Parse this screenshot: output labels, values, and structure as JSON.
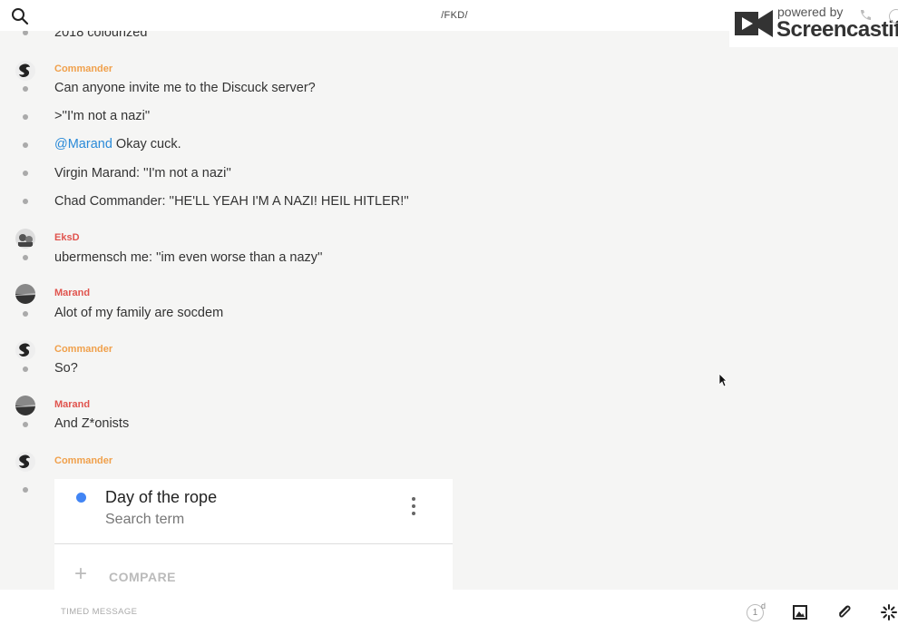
{
  "header": {
    "room_title": "/FKD/",
    "search_icon": "search-icon"
  },
  "watermark": {
    "powered_by": "powered by",
    "brand": "Screencastify"
  },
  "messages": {
    "partial_top": "2018 colourized",
    "g1": {
      "author": "Commander",
      "lines": [
        "Can anyone invite me to the Discuck server?",
        ">''I'm not a nazi''",
        "Okay cuck.",
        "Virgin Marand: ''I'm not a nazi''",
        "Chad Commander: ''HE'LL YEAH I'M A NAZI! HEIL HITLER!''"
      ],
      "mention": "@Marand"
    },
    "g2": {
      "author": "EksD",
      "lines": [
        "ubermensch me: ''im even worse than a nazy''"
      ]
    },
    "g3": {
      "author": "Marand",
      "lines": [
        "Alot of my family are socdem"
      ]
    },
    "g4": {
      "author": "Commander",
      "lines": [
        "So?"
      ]
    },
    "g5": {
      "author": "Marand",
      "lines": [
        "And Z*onists"
      ]
    },
    "g6": {
      "author": "Commander"
    }
  },
  "trend_card": {
    "title": "Day of the rope",
    "subtitle": "Search term",
    "compare_label": "COMPARE",
    "dot_color": "#4285f4"
  },
  "composer": {
    "placeholder": "TIMED MESSAGE",
    "timer_value": "1",
    "timer_unit": "d"
  },
  "colors": {
    "commander": "#f0a04b",
    "other_author": "#e0544e",
    "mention": "#2a8ad8"
  }
}
